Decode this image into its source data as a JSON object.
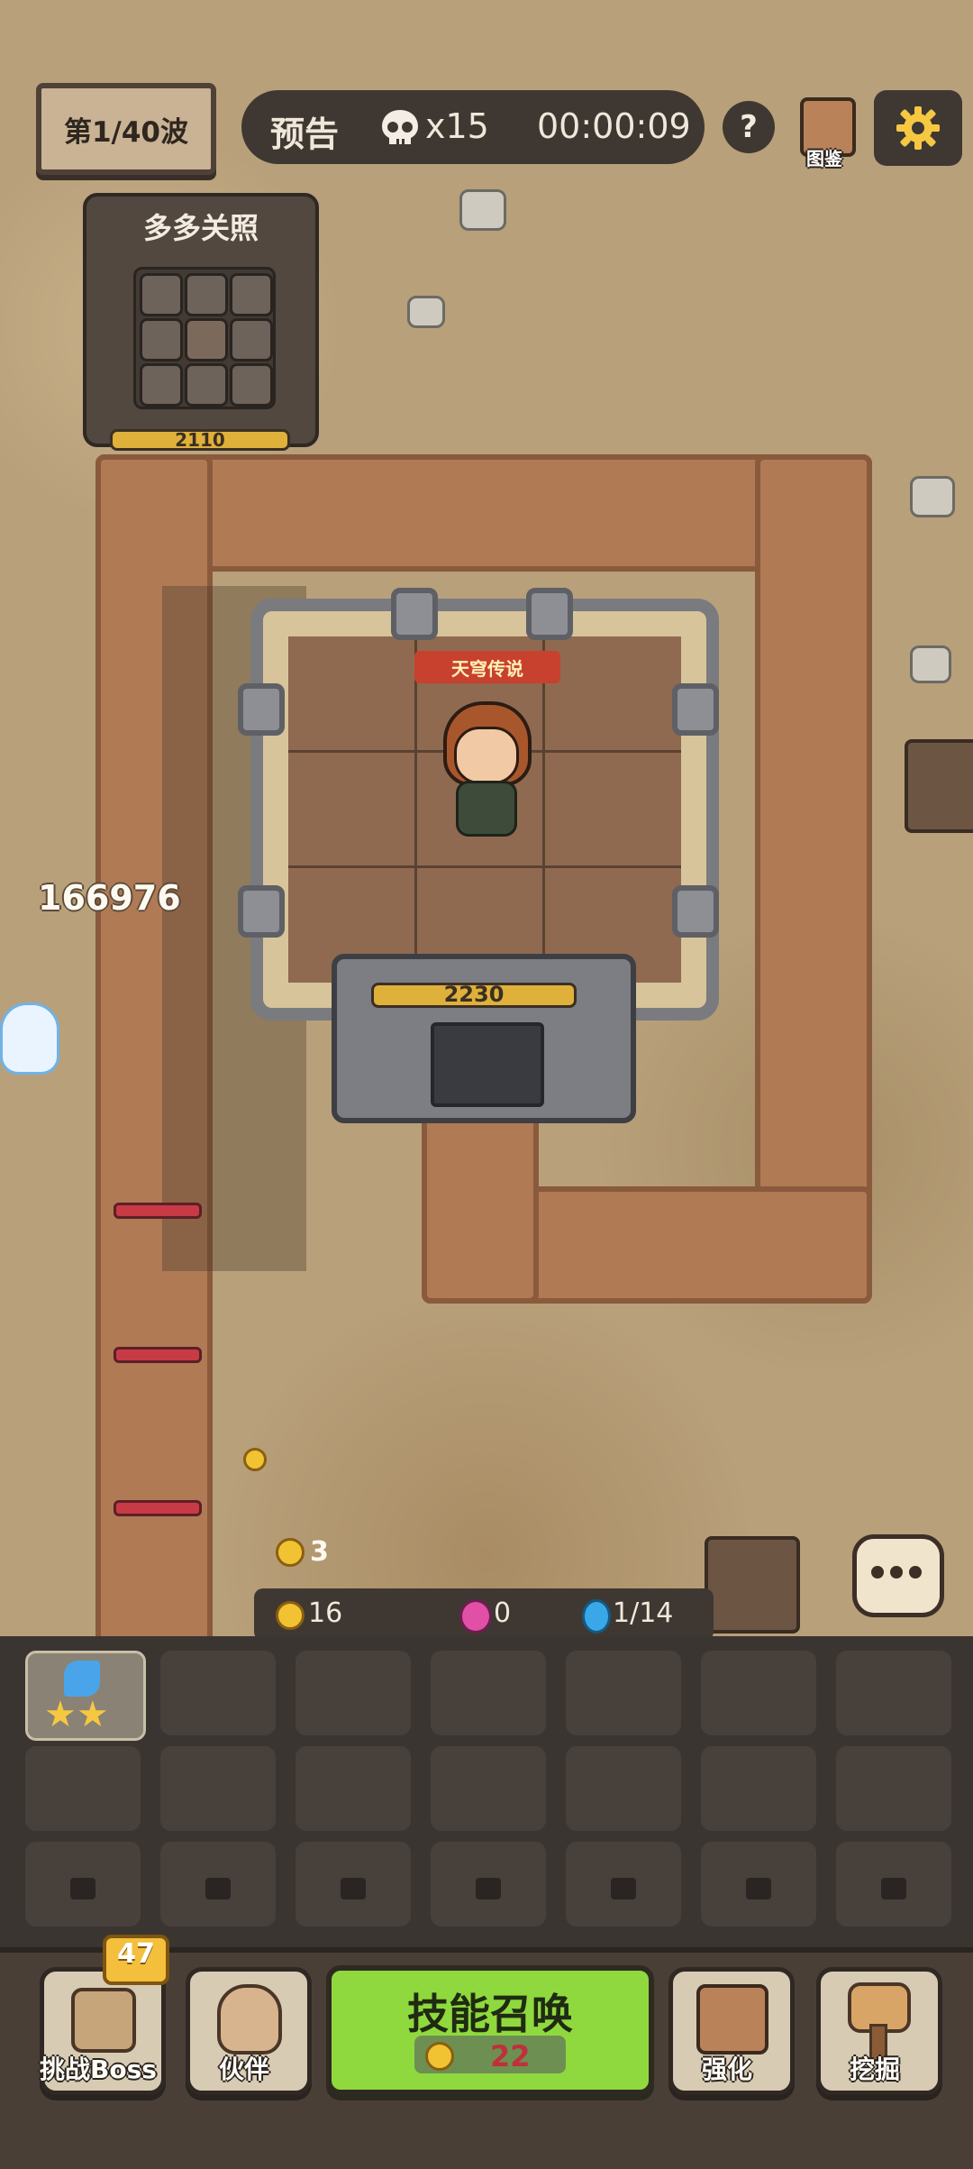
{
  "hud": {
    "wave": "第1/40波",
    "forecast": "预告",
    "enemy_count": "x15",
    "timer": "00:00:09",
    "help": "?",
    "codex": "图鉴"
  },
  "mini_panel": {
    "title": "多多关照",
    "hp": "2110"
  },
  "fort": {
    "hero_tag": "天穹传说",
    "hp": "2230"
  },
  "damage": "166976",
  "coin_drop": "3",
  "resources": {
    "gold": "16",
    "gems": "0",
    "units": "1/14"
  },
  "bottom_menu": {
    "challenge_boss": "挑战Boss",
    "challenge_badge": "47",
    "partner": "伙伴",
    "summon_title": "技能召唤",
    "summon_cost": "22",
    "enhance": "强化",
    "dig": "挖掘"
  },
  "colors": {
    "path": "#b07a55",
    "gold": "#f1c232",
    "summon_green": "#8fd93f",
    "enemy_bar": "#c93a47"
  }
}
